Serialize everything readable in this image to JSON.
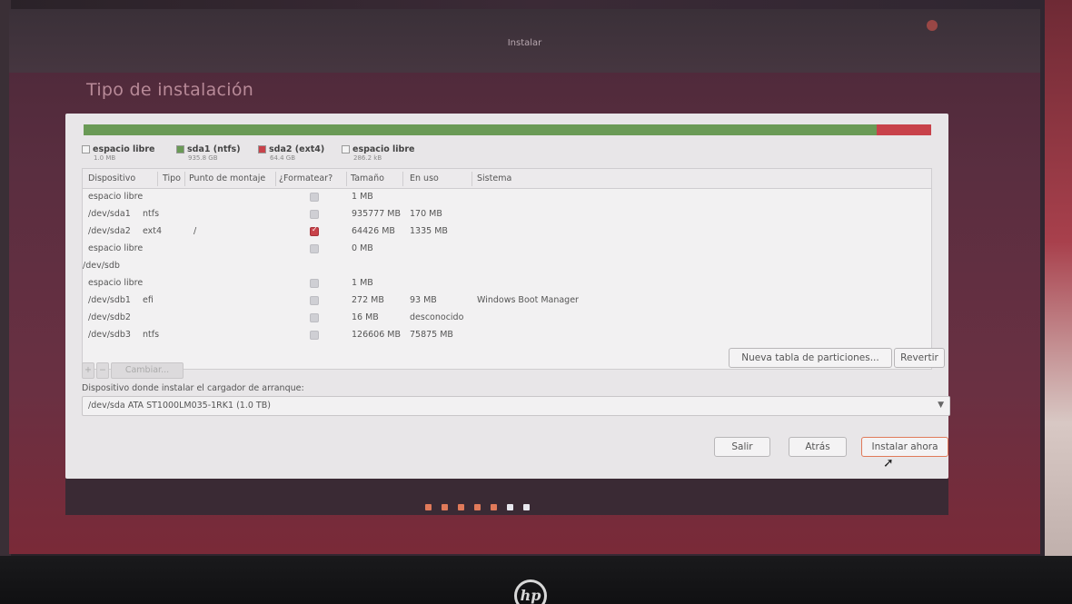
{
  "window": {
    "title": "Instalar"
  },
  "page": {
    "title": "Tipo de instalación"
  },
  "partition_bar": [
    {
      "name": "espacio libre",
      "color": "#e8e6e8",
      "fraction": 0.002
    },
    {
      "name": "sda1 (ntfs)",
      "color": "#6a9a56",
      "fraction": 0.933
    },
    {
      "name": "sda2 (ext4)",
      "color": "#c8424a",
      "fraction": 0.064
    },
    {
      "name": "espacio libre",
      "color": "#e8e6e8",
      "fraction": 0.001
    }
  ],
  "legend": [
    {
      "name": "espacio libre",
      "size": "1.0 MB",
      "color": "#f4f4f4"
    },
    {
      "name": "sda1 (ntfs)",
      "size": "935.8 GB",
      "color": "#6a9a56"
    },
    {
      "name": "sda2 (ext4)",
      "size": "64.4 GB",
      "color": "#c8424a"
    },
    {
      "name": "espacio libre",
      "size": "286.2 kB",
      "color": "#f4f4f4"
    }
  ],
  "table": {
    "headers": [
      "Dispositivo",
      "Tipo",
      "Punto de montaje",
      "¿Formatear?",
      "Tamaño",
      "En uso",
      "Sistema"
    ],
    "rows": [
      {
        "device": "espacio libre",
        "type": "",
        "mount": "",
        "format": "off",
        "size": "1 MB",
        "used": "",
        "system": ""
      },
      {
        "device": "/dev/sda1",
        "type": "ntfs",
        "mount": "",
        "format": "off",
        "size": "935777 MB",
        "used": "170 MB",
        "system": ""
      },
      {
        "device": "/dev/sda2",
        "type": "ext4",
        "mount": "/",
        "format": "on",
        "size": "64426 MB",
        "used": "1335 MB",
        "system": ""
      },
      {
        "device": "espacio libre",
        "type": "",
        "mount": "",
        "format": "off",
        "size": "0 MB",
        "used": "",
        "system": ""
      },
      {
        "device": "/dev/sdb",
        "type": "",
        "mount": "",
        "format": "none",
        "size": "",
        "used": "",
        "system": ""
      },
      {
        "device": "espacio libre",
        "type": "",
        "mount": "",
        "format": "off",
        "size": "1 MB",
        "used": "",
        "system": ""
      },
      {
        "device": "/dev/sdb1",
        "type": "efi",
        "mount": "",
        "format": "off",
        "size": "272 MB",
        "used": "93 MB",
        "system": "Windows Boot Manager"
      },
      {
        "device": "/dev/sdb2",
        "type": "",
        "mount": "",
        "format": "off",
        "size": "16 MB",
        "used": "desconocido",
        "system": ""
      },
      {
        "device": "/dev/sdb3",
        "type": "ntfs",
        "mount": "",
        "format": "off",
        "size": "126606 MB",
        "used": "75875 MB",
        "system": ""
      }
    ]
  },
  "toolbar": {
    "add": "+",
    "remove": "−",
    "change": "Cambiar..."
  },
  "actions": {
    "new_table": "Nueva tabla de particiones...",
    "revert": "Revertir"
  },
  "bootloader": {
    "label": "Dispositivo donde instalar el cargador de arranque:",
    "value": "/dev/sda   ATA ST1000LM035-1RK1 (1.0 TB)"
  },
  "nav": {
    "quit": "Salir",
    "back": "Atrás",
    "install": "Instalar ahora"
  },
  "progress_dots": [
    {
      "color": "#e07a5a"
    },
    {
      "color": "#e07a5a"
    },
    {
      "color": "#e07a5a"
    },
    {
      "color": "#e07a5a"
    },
    {
      "color": "#e07a5a"
    },
    {
      "color": "#e8e8ee"
    },
    {
      "color": "#e8e8ee"
    }
  ],
  "brand": {
    "logo_text": "hp"
  }
}
